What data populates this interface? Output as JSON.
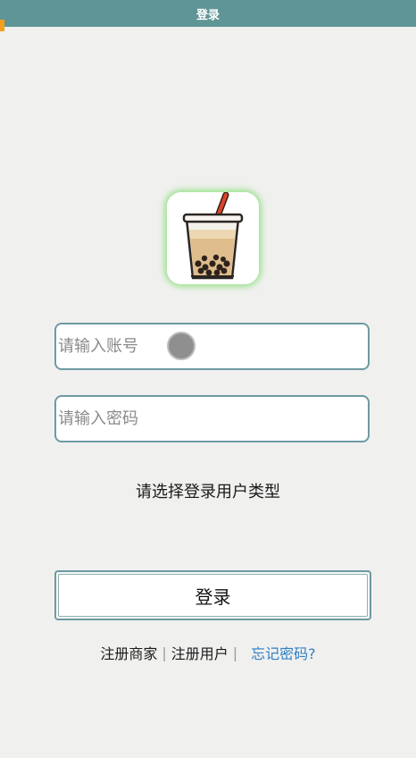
{
  "header": {
    "title": "登录"
  },
  "logo": {
    "icon": "bubble-tea-icon"
  },
  "form": {
    "account_placeholder": "请输入账号",
    "password_placeholder": "请输入密码",
    "user_type_prompt": "请选择登录用户类型",
    "login_label": "登录"
  },
  "links": {
    "register_merchant": "注册商家",
    "separator_1": "|",
    "register_user": "注册用户",
    "separator_2": "|",
    "forgot_password": "忘记密码?"
  },
  "colors": {
    "header_bg": "#5f9596",
    "page_bg": "#f0f0ef",
    "input_border": "#6e9aa2",
    "logo_glow": "#9ee291",
    "link_accent": "#2f7fc4"
  }
}
